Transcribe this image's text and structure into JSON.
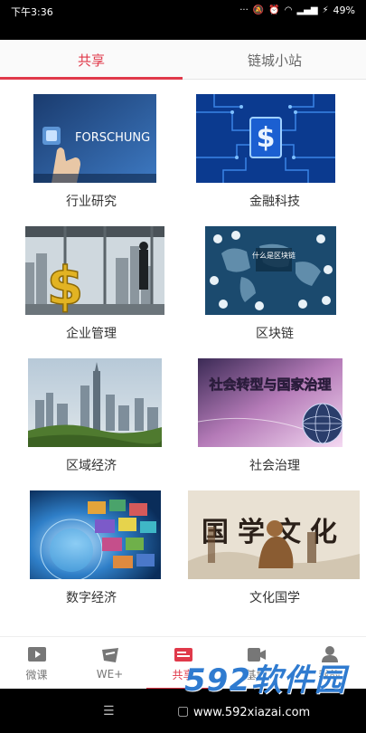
{
  "status_bar": {
    "time": "下午3:36",
    "battery": "49%"
  },
  "top_tabs": [
    {
      "label": "共享",
      "active": true
    },
    {
      "label": "链城小站",
      "active": false
    }
  ],
  "grid": [
    {
      "label": "行业研究",
      "image_text": "FORSCHUNG"
    },
    {
      "label": "金融科技",
      "image_text": "$"
    },
    {
      "label": "企业管理",
      "image_text": "$"
    },
    {
      "label": "区块链",
      "image_text": "什么是区块链"
    },
    {
      "label": "区域经济",
      "image_text": ""
    },
    {
      "label": "社会治理",
      "image_text": "社会转型与国家治理"
    },
    {
      "label": "数字经济",
      "image_text": ""
    },
    {
      "label": "文化国学",
      "image_text": "国学文化"
    }
  ],
  "bottom_nav": [
    {
      "label": "微课",
      "icon": "play-video-icon"
    },
    {
      "label": "WE+",
      "icon": "we-plus-icon"
    },
    {
      "label": "共享",
      "icon": "share-card-icon",
      "active": true
    },
    {
      "label": "基地",
      "icon": "camera-icon"
    },
    {
      "label": "我的",
      "icon": "person-icon"
    }
  ],
  "watermark": {
    "brand": "592软件园",
    "url": "www.592xiazai.com"
  },
  "colors": {
    "accent": "#e0394a"
  }
}
